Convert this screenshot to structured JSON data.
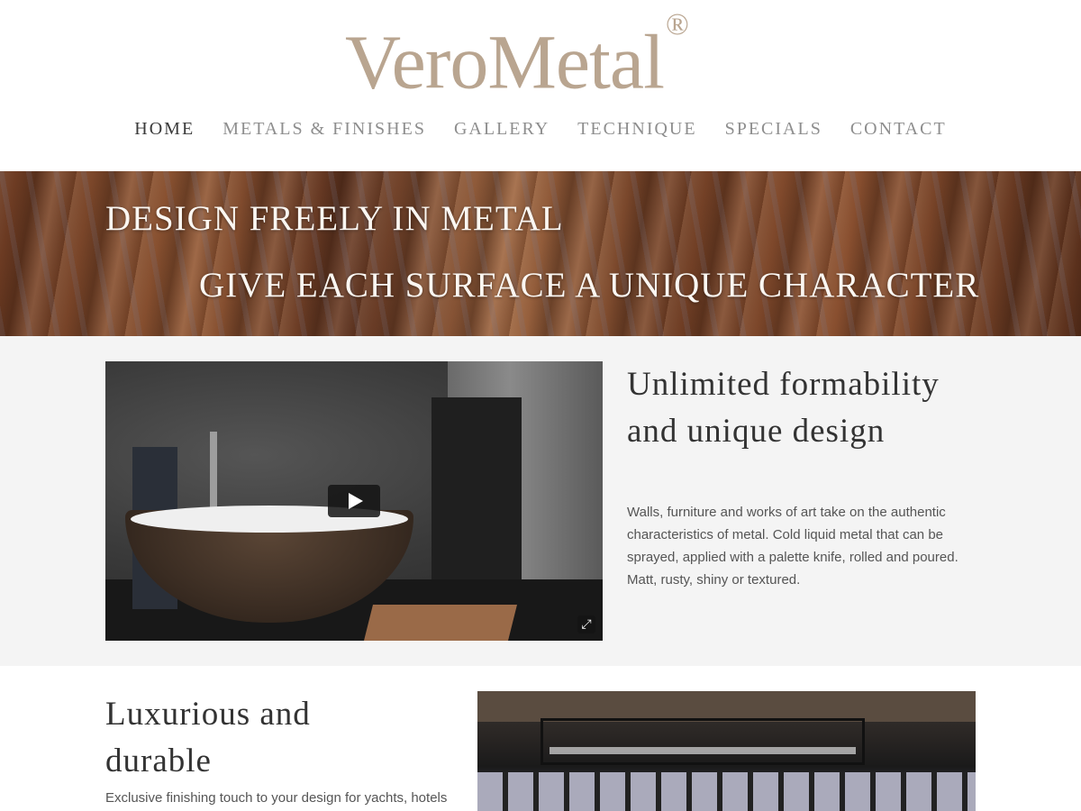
{
  "brand": {
    "name": "VeroMetal",
    "mark": "®"
  },
  "nav": [
    {
      "label": "HOME",
      "active": true
    },
    {
      "label": "METALS & FINISHES",
      "active": false
    },
    {
      "label": "GALLERY",
      "active": false
    },
    {
      "label": "TECHNIQUE",
      "active": false
    },
    {
      "label": "SPECIALS",
      "active": false
    },
    {
      "label": "CONTACT",
      "active": false
    }
  ],
  "hero": {
    "line1": "DESIGN FREELY IN METAL",
    "line2": "GIVE EACH SURFACE A UNIQUE CHARACTER"
  },
  "section1": {
    "title": "Unlimited formability and unique design",
    "text": "Walls, furniture and works of art take on the authentic characteristics of metal. Cold liquid metal that can be sprayed, applied with a palette knife, rolled and poured. Matt, rusty, shiny or textured.",
    "video": {
      "play_icon": "play-icon",
      "fullscreen_icon": "fullscreen-icon"
    }
  },
  "section2": {
    "title": "Luxurious and durable",
    "text": "Exclusive finishing touch to your design for yachts, hotels"
  },
  "colors": {
    "logo": "#b9a590",
    "section_bg": "#f4f4f4",
    "nav_active": "#3a3a3a",
    "nav": "#8e8e8e"
  }
}
